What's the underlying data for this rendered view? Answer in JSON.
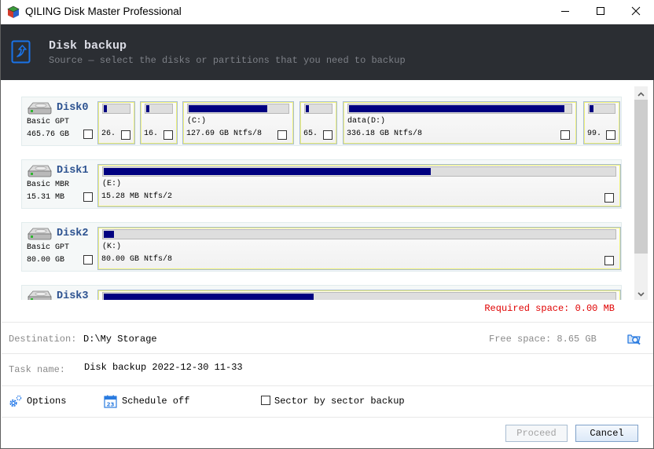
{
  "window": {
    "title": "QILING Disk Master Professional",
    "controls": {
      "minimize": "minimize",
      "maximize": "maximize",
      "close": "close"
    }
  },
  "header": {
    "icon": "disk-backup-icon",
    "title": "Disk backup",
    "subtitle": "Source — select the disks or partitions that you need to backup"
  },
  "disks": [
    {
      "name": "Disk0",
      "type": "Basic GPT",
      "size": "465.76 GB",
      "selected": false,
      "partitions": [
        {
          "label": "",
          "size": "26.",
          "used": 0.12,
          "selected": false
        },
        {
          "label": "",
          "size": "16.",
          "used": 0.12,
          "selected": false
        },
        {
          "label": "(C:)",
          "size": "127.69 GB Ntfs/8",
          "used": 0.79,
          "selected": false
        },
        {
          "label": "",
          "size": "65.",
          "used": 0.14,
          "selected": false
        },
        {
          "label": "data(D:)",
          "size": "336.18 GB Ntfs/8",
          "used": 0.97,
          "selected": false
        },
        {
          "label": "",
          "size": "99.",
          "used": 0.15,
          "selected": false
        }
      ]
    },
    {
      "name": "Disk1",
      "type": "Basic MBR",
      "size": "15.31 MB",
      "selected": false,
      "partitions": [
        {
          "label": "(E:)",
          "size": "15.28 MB Ntfs/2",
          "used": 0.64,
          "selected": false
        }
      ]
    },
    {
      "name": "Disk2",
      "type": "Basic GPT",
      "size": "80.00 GB",
      "selected": false,
      "partitions": [
        {
          "label": "(K:)",
          "size": "80.00 GB Ntfs/8",
          "used": 0.02,
          "selected": false
        }
      ]
    },
    {
      "name": "Disk3",
      "partitions": [
        {
          "used": 0.41
        }
      ]
    }
  ],
  "summary": {
    "required_space": "Required space: 0.00 MB"
  },
  "destination": {
    "label": "Destination:",
    "value": "D:\\My Storage",
    "free_space": "Free space: 8.65 GB",
    "browse_icon": "folder-search-icon"
  },
  "task": {
    "label": "Task name:",
    "value": "Disk backup 2022-12-30 11-33"
  },
  "options": {
    "options_label": "Options",
    "schedule_label": "Schedule off",
    "calendar_day": "23",
    "sector_label": "Sector by sector backup",
    "sector_checked": false
  },
  "buttons": {
    "proceed": "Proceed",
    "cancel": "Cancel",
    "proceed_enabled": false
  },
  "colors": {
    "header_bg": "#2b2e33",
    "accent_blue": "#1a73e8",
    "usage_fill": "#000080",
    "required_text": "#e00000",
    "disk_name": "#2c5290"
  }
}
